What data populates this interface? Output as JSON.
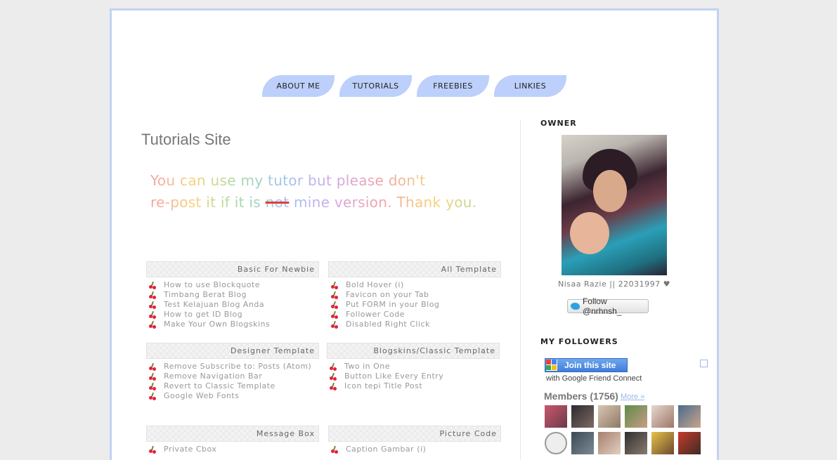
{
  "nav": [
    {
      "label": "ABOUT ME"
    },
    {
      "label": "TUTORIALS"
    },
    {
      "label": "FREEBIES"
    },
    {
      "label": "LINKIES"
    }
  ],
  "main": {
    "title": "Tutorials Site",
    "notice": {
      "line1": "You can use my tutor but please don't",
      "line2_a": "re-post it if it is ",
      "line2_strike": "not",
      "line2_b": " mine version. Thank you."
    }
  },
  "boxes": [
    {
      "title": "Basic For Newbie",
      "items": [
        "How to use Blockquote",
        "Timbang Berat Blog",
        "Test Kelajuan Blog Anda",
        "How to get ID Blog",
        "Make Your Own Blogskins"
      ]
    },
    {
      "title": "All Template",
      "items": [
        "Bold Hover (i)",
        "Favicon on your Tab",
        "Put FORM in your Blog",
        "Follower Code",
        "Disabled Right Click"
      ]
    },
    {
      "title": "Designer Template",
      "items": [
        "Remove Subscribe to: Posts (Atom)",
        "Remove Navigation Bar",
        "Revert to Classic Template",
        "Google Web Fonts"
      ]
    },
    {
      "title": "Blogskins/Classic Template",
      "items": [
        "Two in One",
        "Button Like Every Entry",
        "Icon tepi Title Post"
      ]
    },
    {
      "title": "Message Box",
      "items": [
        "Private Cbox"
      ]
    },
    {
      "title": "Picture Code",
      "items": [
        "Caption Gambar (i)"
      ]
    }
  ],
  "sidebar": {
    "owner_title": "OWNER",
    "owner_caption": "Nisaa Razie || 22031997 ♥",
    "follow_label": "Follow @nrhnsh_",
    "followers_title": "MY FOLLOWERS",
    "join_label": "Join this site",
    "gfc_text": "with Google Friend Connect",
    "members_label": "Members (1756)",
    "more_label": "More »"
  },
  "colors": {
    "accent": "#bcd0fb",
    "frame_border": "#c2d2f5",
    "bullet": "#e2223b"
  }
}
